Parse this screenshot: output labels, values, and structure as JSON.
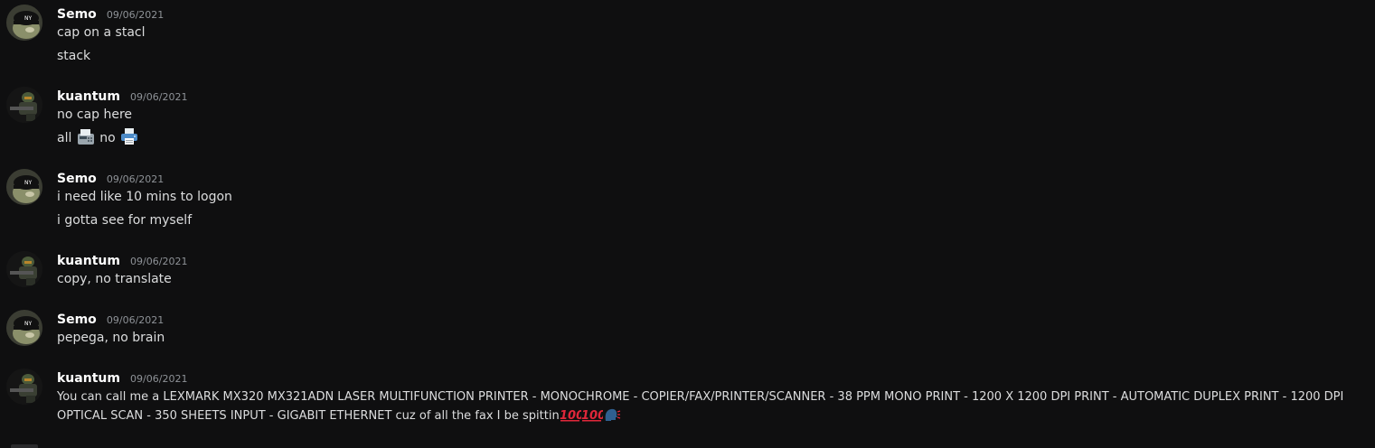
{
  "messages": [
    {
      "author": "Semo",
      "avatar": "semo-avatar",
      "timestamp": "09/06/2021",
      "lines": [
        "cap on a stacl",
        "stack"
      ]
    },
    {
      "author": "kuantum",
      "avatar": "kuantum-avatar",
      "timestamp": "09/06/2021",
      "lines": [
        "no cap here"
      ],
      "emoji_line": {
        "prefix": "all",
        "middle": "no",
        "emoji_1": "fax-machine-icon",
        "emoji_2": "printer-icon"
      }
    },
    {
      "author": "Semo",
      "avatar": "semo-avatar",
      "timestamp": "09/06/2021",
      "lines": [
        "i need like 10 mins to logon",
        "i gotta see for myself"
      ]
    },
    {
      "author": "kuantum",
      "avatar": "kuantum-avatar",
      "timestamp": "09/06/2021",
      "lines": [
        "copy, no translate"
      ]
    },
    {
      "author": "Semo",
      "avatar": "semo-avatar",
      "timestamp": "09/06/2021",
      "lines": [
        "pepega, no brain"
      ]
    },
    {
      "author": "kuantum",
      "avatar": "kuantum-avatar",
      "timestamp": "09/06/2021",
      "lines": [
        "You can call me a LEXMARK MX320 MX321ADN LASER MULTIFUNCTION PRINTER - MONOCHROME - COPIER/FAX/PRINTER/SCANNER - 38 PPM MONO PRINT - 1200 X 1200 DPI PRINT - AUTOMATIC DUPLEX PRINT - 1200 DPI OPTICAL SCAN - 350 SHEETS INPUT - GIGABIT ETHERNET cuz of all the fax I be spittin"
      ],
      "trailing_emoji": [
        "hundred-points-icon",
        "hundred-points-icon",
        "speaking-head-icon"
      ]
    }
  ],
  "colors": {
    "background": "#0f0f10",
    "username": "#ffffff",
    "timestamp": "#8e9297",
    "text": "#dcddde"
  }
}
